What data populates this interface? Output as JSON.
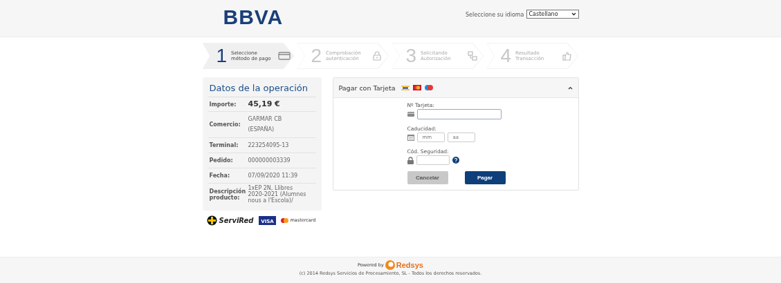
{
  "header": {
    "logo": "BBVA",
    "language_label": "Seleccione su idioma",
    "language": "Castellano"
  },
  "steps": [
    {
      "number": "1",
      "label": "Seleccione método de pago",
      "selected": true
    },
    {
      "number": "2",
      "label": "Comprobación autenticación",
      "selected": false
    },
    {
      "number": "3",
      "label": "Solicitando Autorización",
      "selected": false
    },
    {
      "number": "4",
      "label": "Resultado Transacción",
      "selected": false
    }
  ],
  "operation": {
    "title": "Datos de la operación",
    "rows": [
      {
        "label": "Importe:",
        "value": "45,19 €",
        "kind": "amount"
      },
      {
        "label": "Comercio:",
        "value": "GARMAR CB (ESPAÑA)",
        "kind": "text"
      },
      {
        "label": "Terminal:",
        "value": "223254095-13",
        "kind": "text"
      },
      {
        "label": "Pedido:",
        "value": "000000003339",
        "kind": "text"
      },
      {
        "label": "Fecha:",
        "value": "07/09/2020  11:39",
        "kind": "text"
      },
      {
        "label": "Descripción producto:",
        "value": "1xEP 2N, Llibres 2020-2021 (Alumnes nous a l'Escola)/",
        "kind": "small"
      }
    ]
  },
  "brands": {
    "servired": "ServiRed",
    "visa": "VISA",
    "mastercard": "mastercard"
  },
  "payment": {
    "title": "Pagar con Tarjeta",
    "expanded": true,
    "card_label": "Nº Tarjeta:",
    "expiry_label": "Caducidad:",
    "month_placeholder": "mm",
    "year_placeholder": "aa",
    "cvv_label": "Cód. Seguridad:",
    "cancel": "Cancelar",
    "cancel_disabled": true,
    "pay": "Pagar"
  },
  "footer": {
    "powered_by": "Powered by",
    "brand": "Redsys",
    "copyright": "(c) 2014 Redsys Servicios de Procesamiento, SL - Todos los derechos reservados."
  }
}
